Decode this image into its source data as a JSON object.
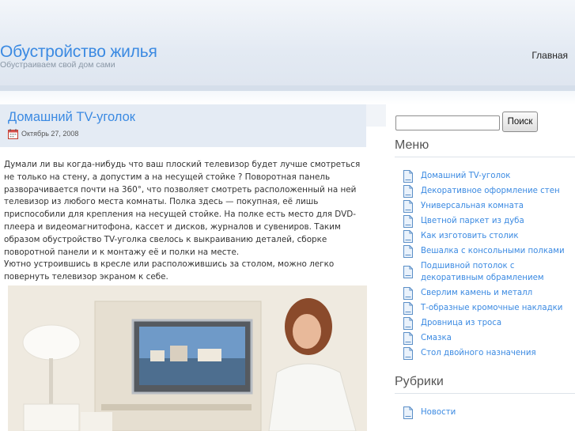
{
  "site": {
    "title": "Обустройство жилья",
    "description": "Обустраиваем свой дом сами"
  },
  "nav": {
    "home": "Главная"
  },
  "post": {
    "title": "Домашний TV-уголок",
    "date": "Октябрь 27, 2008",
    "paragraph1": "Думали ли вы когда-нибудь что ваш плоский телевизор будет лучше смотреться не только на стену, а допустим а на несущей стойке ? Поворотная панель разворачивается почти на 360°, что позволяет смотреть расположенный на ней телевизор из любого места комнаты. Полка здесь — покупная, её лишь приспособили для крепления на несущей стойке. На полке есть место для DVD-плеера и видеомагнитофона, кассет и дисков, журналов и сувениров. Таким образом обустройство TV-уголка свелось к выкраиванию деталей, сборке поворотной панели и к монтажу её и полки на месте.",
    "paragraph2": "Уютно устроившись в кресле или расположившись за столом, можно легко повернуть телевизор экраном к себе."
  },
  "sidebar": {
    "search_button": "Поиск",
    "search_value": "",
    "menu_title": "Меню",
    "menu_items": [
      "Домашний TV-уголок",
      "Декоративное оформление стен",
      "Универсальная комната",
      "Цветной паркет из дуба",
      "Как изготовить столик",
      "Вешалка с консольными полками",
      "Подшивной потолок с декоративным обрамлением",
      "Сверлим камень и металл",
      "Т-образные кромочные накладки",
      "Дровница из троса",
      "Смазка",
      "Стол двойного назначения"
    ],
    "categories_title": "Рубрики",
    "categories": [
      "Новости"
    ]
  },
  "colors": {
    "link": "#3b8ae2",
    "header_bg": "#e3eaf3",
    "post_head_bg": "#e4ebf4",
    "text": "#333333"
  },
  "icons": {
    "date": "calendar-icon",
    "menu_item": "page-icon"
  }
}
